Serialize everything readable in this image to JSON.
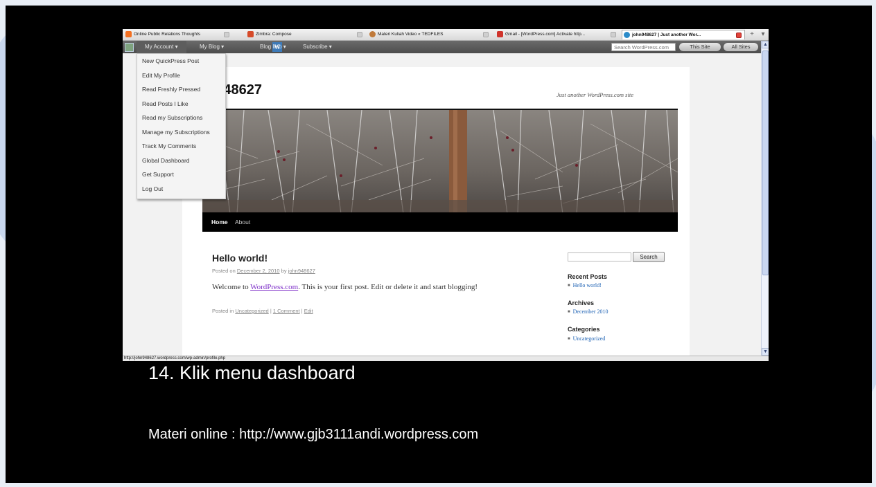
{
  "browser": {
    "tabs": [
      {
        "title": "Online Public Relations Thoughts",
        "icon": "blogger-icon",
        "icon_color": "#f37021"
      },
      {
        "title": "Zimbra: Compose",
        "icon": "zimbra-icon",
        "icon_color": "#d64b2a"
      },
      {
        "title": "Materi Kuliah Video « TEDFILES",
        "icon": "ted-icon",
        "icon_color": "#c07a3a"
      },
      {
        "title": "Gmail - [WordPress.com] Activate http...",
        "icon": "gmail-icon",
        "icon_color": "#d0342c"
      },
      {
        "title": "john948627 | Just another Wor...",
        "icon": "wordpress-icon",
        "icon_color": "#2b8bc9"
      }
    ],
    "new_tab": "+",
    "status_url": "http://john948627.wordpress.com/wp-admin/profile.php"
  },
  "adminbar": {
    "my_account": "My Account ▾",
    "my_blog": "My Blog ▾",
    "blog_info": "Blog Info ▾",
    "subscribe": "Subscribe ▾",
    "search_placeholder": "Search WordPress.com",
    "this_site": "This Site",
    "all_sites": "All Sites"
  },
  "dropdown": {
    "items": [
      "New QuickPress Post",
      "Edit My Profile",
      "Read Freshly Pressed",
      "Read Posts I Like",
      "Read my Subscriptions",
      "Manage my Subscriptions",
      "Track My Comments",
      "Global Dashboard",
      "Get Support",
      "Log Out"
    ]
  },
  "site": {
    "title": "n948627",
    "description": "Just another WordPress.com site",
    "nav": [
      "Home",
      "About"
    ]
  },
  "post": {
    "title": "Hello world!",
    "meta_prefix": "Posted on ",
    "date": "December 2, 2010",
    "meta_by": " by ",
    "author": "john948627",
    "body_prefix": "Welcome to ",
    "body_link": "WordPress.com",
    "body_suffix": ". This is your first post. Edit or delete it and start blogging!",
    "foot_prefix": "Posted in ",
    "category": "Uncategorized",
    "sep1": " | ",
    "comments": "1 Comment",
    "sep2": " | ",
    "edit": "Edit"
  },
  "sidebar": {
    "search_button": "Search",
    "recent_posts_title": "Recent Posts",
    "recent_posts": [
      "Hello world!"
    ],
    "archives_title": "Archives",
    "archives": [
      "December 2010"
    ],
    "categories_title": "Categories",
    "categories": [
      "Uncategorized"
    ]
  },
  "slide": {
    "caption": "14. Klik menu dashboard",
    "footer": "Materi online : http://www.gjb3111andi.wordpress.com"
  },
  "colors": {
    "adminbar": "#555555",
    "link": "#1b60b3",
    "visited_link": "#7d2ec8",
    "slide_background": "#000000"
  }
}
